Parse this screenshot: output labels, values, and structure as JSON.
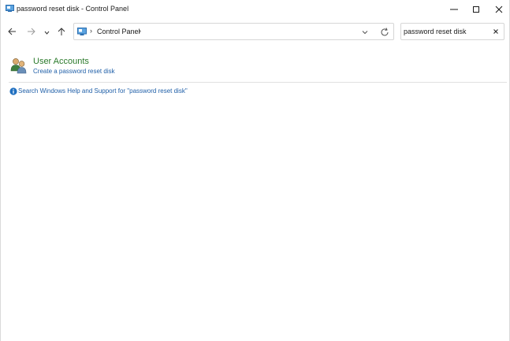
{
  "window": {
    "title": "password reset disk - Control Panel",
    "app_icon": "control-panel-icon",
    "buttons": {
      "minimize_icon": "minimize-icon",
      "maximize_icon": "maximize-icon",
      "close_icon": "close-icon"
    }
  },
  "nav": {
    "back_icon": "arrow-left-icon",
    "forward_icon": "arrow-right-icon",
    "recent_icon": "chevron-down-icon",
    "up_icon": "arrow-up-icon"
  },
  "address": {
    "location_icon": "control-panel-icon",
    "separator": "›",
    "crumbs": [
      "Control Panel"
    ],
    "trailing_separator": "›",
    "dropdown_icon": "chevron-down-icon",
    "refresh_icon": "refresh-icon"
  },
  "search": {
    "value": "password reset disk",
    "clear_icon": "close-icon"
  },
  "results": [
    {
      "category": "User Accounts",
      "icon": "user-accounts-icon",
      "tasks": [
        "Create a password reset disk"
      ]
    }
  ],
  "help": {
    "icon": "info-icon",
    "label": "Search Windows Help and Support for \"password reset disk\""
  },
  "colors": {
    "category_green": "#2b7a2b",
    "link_blue": "#1f5fa8",
    "info_blue": "#1f6fc0"
  }
}
